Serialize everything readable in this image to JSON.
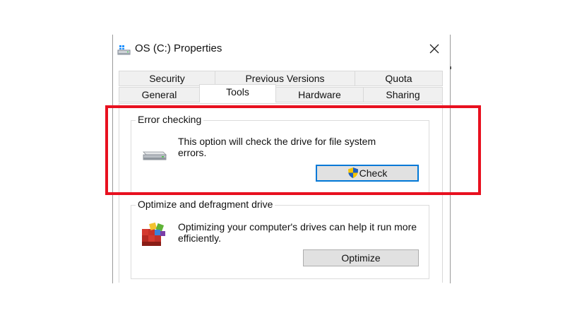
{
  "window": {
    "title": "OS (C:) Properties",
    "icons": {
      "title": "drive-icon",
      "close": "close-icon"
    }
  },
  "tabs": {
    "row1": [
      "Security",
      "Previous Versions",
      "Quota"
    ],
    "row2": [
      "General",
      "Tools",
      "Hardware",
      "Sharing"
    ],
    "active": "Tools"
  },
  "error_checking": {
    "heading": "Error checking",
    "description_line1": "This option will check the drive for file system",
    "description_line2": "errors.",
    "button_label": "Check",
    "icons": {
      "drive": "hard-drive-icon",
      "button": "uac-shield-icon"
    }
  },
  "optimize": {
    "heading": "Optimize and defragment drive",
    "description_line1": "Optimizing your computer's drives can help it run more",
    "description_line2": "efficiently.",
    "button_label": "Optimize",
    "icon": "defragment-icon"
  },
  "colors": {
    "highlight": "#e8101f",
    "focus": "#0078d7",
    "button_bg": "#e1e1e1"
  }
}
